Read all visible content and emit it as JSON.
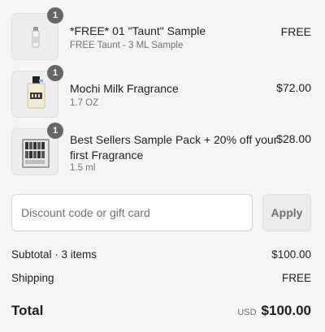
{
  "items": [
    {
      "quantity": "1",
      "name": "*FREE* 01 \"Taunt\" Sample",
      "variant": "FREE Taunt - 3 ML Sample",
      "price": "FREE",
      "icon": "sample-vial-icon"
    },
    {
      "quantity": "1",
      "name": "Mochi Milk Fragrance",
      "variant": "1.7 OZ",
      "price": "$72.00",
      "icon": "perfume-bottle-icon"
    },
    {
      "quantity": "1",
      "name_line1": "Best Sellers Sample Pack + 20% off your",
      "name_line2": "first Fragrance",
      "variant": "1.5 ml",
      "price": "$28.00",
      "icon": "sample-pack-icon"
    }
  ],
  "discount": {
    "placeholder": "Discount code or gift card",
    "value": "",
    "apply_label": "Apply"
  },
  "summary": {
    "subtotal_label": "Subtotal · 3 items",
    "subtotal_value": "$100.00",
    "shipping_label": "Shipping",
    "shipping_value": "FREE",
    "total_label": "Total",
    "currency": "USD",
    "total_value": "$100.00"
  }
}
